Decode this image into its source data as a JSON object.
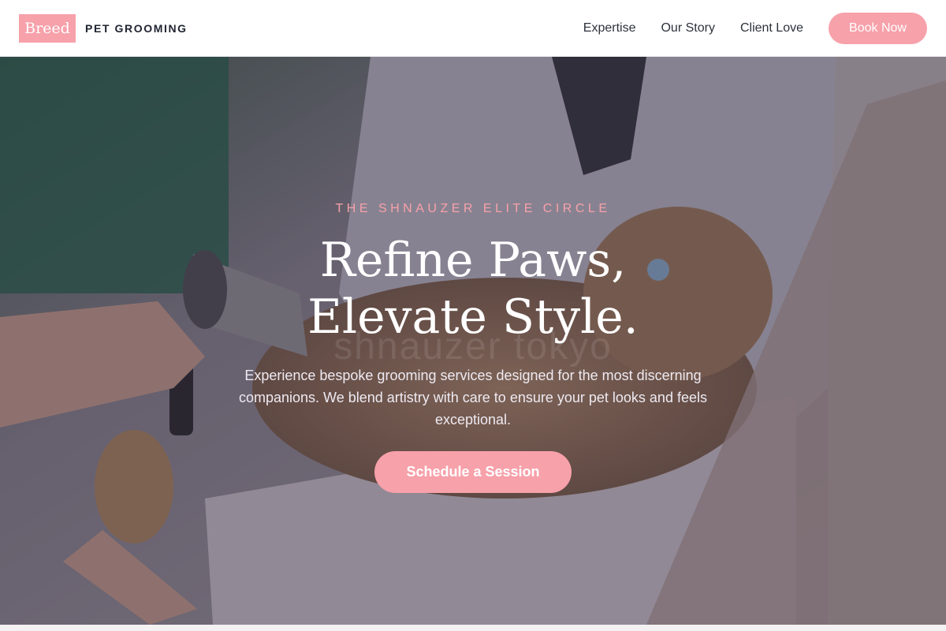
{
  "header": {
    "brand_badge": "Breed",
    "brand_text": "PET GROOMING",
    "nav": [
      "Expertise",
      "Our Story",
      "Client Love"
    ],
    "cta_label": "Book Now"
  },
  "hero": {
    "eyebrow": "THE SHNAUZER ELITE CIRCLE",
    "headline_line1": "Refine Paws,",
    "headline_line2": "Elevate Style.",
    "watermark": "shnauzer tokyo",
    "lead": "Experience bespoke grooming services designed for the most discerning companions. We blend artistry with care to ensure your pet looks and feels exceptional.",
    "cta_label": "Schedule a Session"
  },
  "colors": {
    "accent": "#f7a1aa",
    "nav_text": "#2d323c",
    "overlay": "#3a3446"
  }
}
